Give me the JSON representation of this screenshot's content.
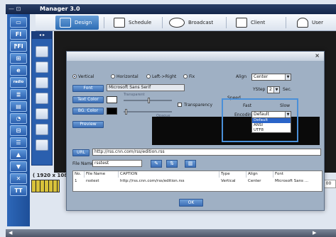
{
  "window": {
    "title": "Manager 3.0",
    "controls": "— ⊡"
  },
  "topnav": {
    "tabs": [
      {
        "label": "Design",
        "icon": "design-icon",
        "active": true
      },
      {
        "label": "Schedule",
        "icon": "calendar-icon",
        "active": false
      },
      {
        "label": "Broadcast",
        "icon": "broadcast-icon",
        "active": false
      },
      {
        "label": "Client",
        "icon": "monitor-icon",
        "active": false
      },
      {
        "label": "User",
        "icon": "user-icon",
        "active": false
      }
    ]
  },
  "lefttoolbar": {
    "items": [
      {
        "label": "▭",
        "icon": "layout-icon"
      },
      {
        "label": "FI",
        "icon": "fi-icon"
      },
      {
        "label": "⁋FI",
        "icon": "fi-text-icon"
      },
      {
        "label": "⊞",
        "icon": "calendar-icon"
      },
      {
        "label": "e",
        "icon": "internet-icon"
      },
      {
        "label": "radio",
        "icon": "radio-icon"
      },
      {
        "label": "≣",
        "icon": "rss-icon"
      },
      {
        "label": "▤",
        "icon": "subtitle-icon"
      },
      {
        "label": "◔",
        "icon": "clock-icon"
      },
      {
        "label": "⊟",
        "icon": "panel-icon"
      },
      {
        "label": "☰",
        "icon": "list-icon"
      },
      {
        "label": "▲",
        "icon": "up-icon"
      },
      {
        "label": "▼",
        "icon": "down-icon"
      },
      {
        "label": "✕",
        "icon": "delete-icon"
      },
      {
        "label": "TT",
        "icon": "text-icon"
      }
    ]
  },
  "resolution": "( 1920 x 1080",
  "bottom_right_value": "00",
  "dialog": {
    "close": "×",
    "direction_options": [
      "Vertical",
      "Horizontal",
      "Left->Right",
      "Fix"
    ],
    "selected_direction": "Vertical",
    "font_button": "Font",
    "font_value": "Microsoft Sans Serif",
    "text_color_button": "Text Color",
    "bg_color_button": "BG. Color",
    "transparency_label": "Transparency",
    "transparent_slider_label": "Transparent",
    "opaque_slider_label": "Opaque",
    "preview_button": "Preview",
    "align_label": "Align",
    "align_value": "Center",
    "ystep_label": "YStep",
    "ystep_value": "2",
    "ystep_unit": "Sec.",
    "speed_label": "Speed",
    "speed_fast": "Fast",
    "speed_slow": "Slow",
    "encoding_label": "Encoding",
    "encoding_value": "Default",
    "encoding_options": [
      "Default",
      "ANSI",
      "UTF8"
    ],
    "encoding_highlighted": "Default",
    "url_button": "URL",
    "url_value": "http://rss.cnn.com/rss/edition.rss",
    "filename_label": "File Name",
    "filename_value": "rsstest",
    "table": {
      "columns": [
        "No.",
        "File Name",
        "CAPTION",
        "Type",
        "Align",
        "Font"
      ],
      "rows": [
        [
          "1",
          "rsstest",
          "http://rss.cnn.com/rss/edition.rss",
          "Vertical",
          "Center",
          "Microsoft Sans ..."
        ]
      ]
    },
    "ok_button": "OK"
  },
  "colors": {
    "toolbar_blue": "#2d67b8",
    "active_tab": "#2c6cb4",
    "highlight_border": "#4a8fd8",
    "dialog_bg": "#9fb0c4",
    "text_color_swatch": "#ffffff",
    "bg_color_swatch": "#000000"
  }
}
